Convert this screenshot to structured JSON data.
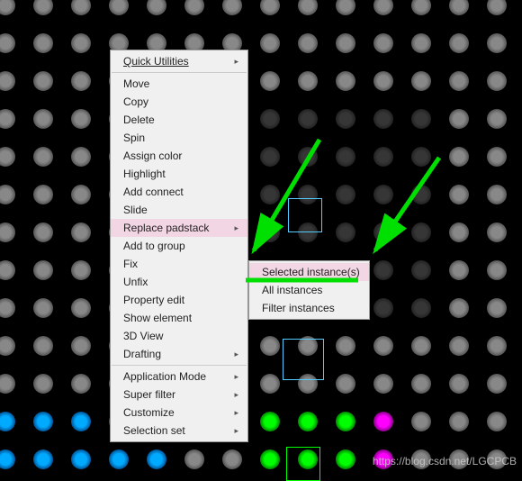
{
  "menu1": {
    "quick": "Quick Utilities",
    "move": "Move",
    "copy": "Copy",
    "delete": "Delete",
    "spin": "Spin",
    "assign": "Assign color",
    "highlight": "Highlight",
    "addconn": "Add connect",
    "slide": "Slide",
    "replace": "Replace padstack",
    "addgrp": "Add to group",
    "fix": "Fix",
    "unfix": "Unfix",
    "prop": "Property edit",
    "showel": "Show element",
    "view3d": "3D View",
    "drafting": "Drafting",
    "appmode": "Application Mode",
    "sfilter": "Super filter",
    "customize": "Customize",
    "selset": "Selection set"
  },
  "menu2": {
    "sel": "Selected instance(s)",
    "all": "All instances",
    "filt": "Filter instances"
  },
  "watermark": "https://blog.csdn.net/LGCPCB"
}
